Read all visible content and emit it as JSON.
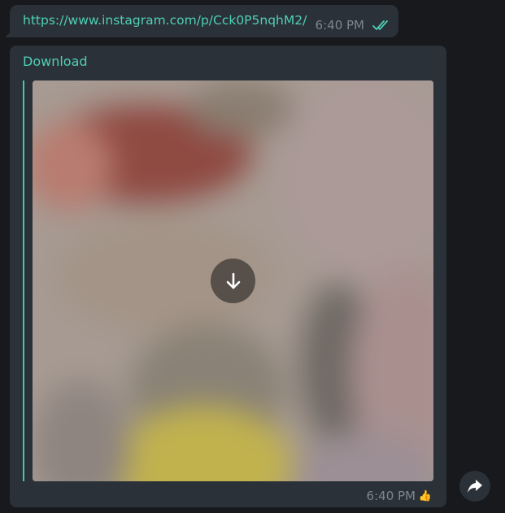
{
  "link_message": {
    "url": "https://www.instagram.com/p/Cck0P5nqhM2/",
    "time": "6:40 PM",
    "status_icon": "double-check-icon"
  },
  "media_message": {
    "header_label": "Download",
    "preview_icon": "download-arrow-icon",
    "time": "6:40 PM",
    "reaction": "👍"
  },
  "actions": {
    "forward_icon": "forward-arrow-icon"
  },
  "colors": {
    "background": "#17191d",
    "bubble": "#2b3138",
    "accent": "#4fd0b6",
    "meta_text": "#7d858e"
  }
}
